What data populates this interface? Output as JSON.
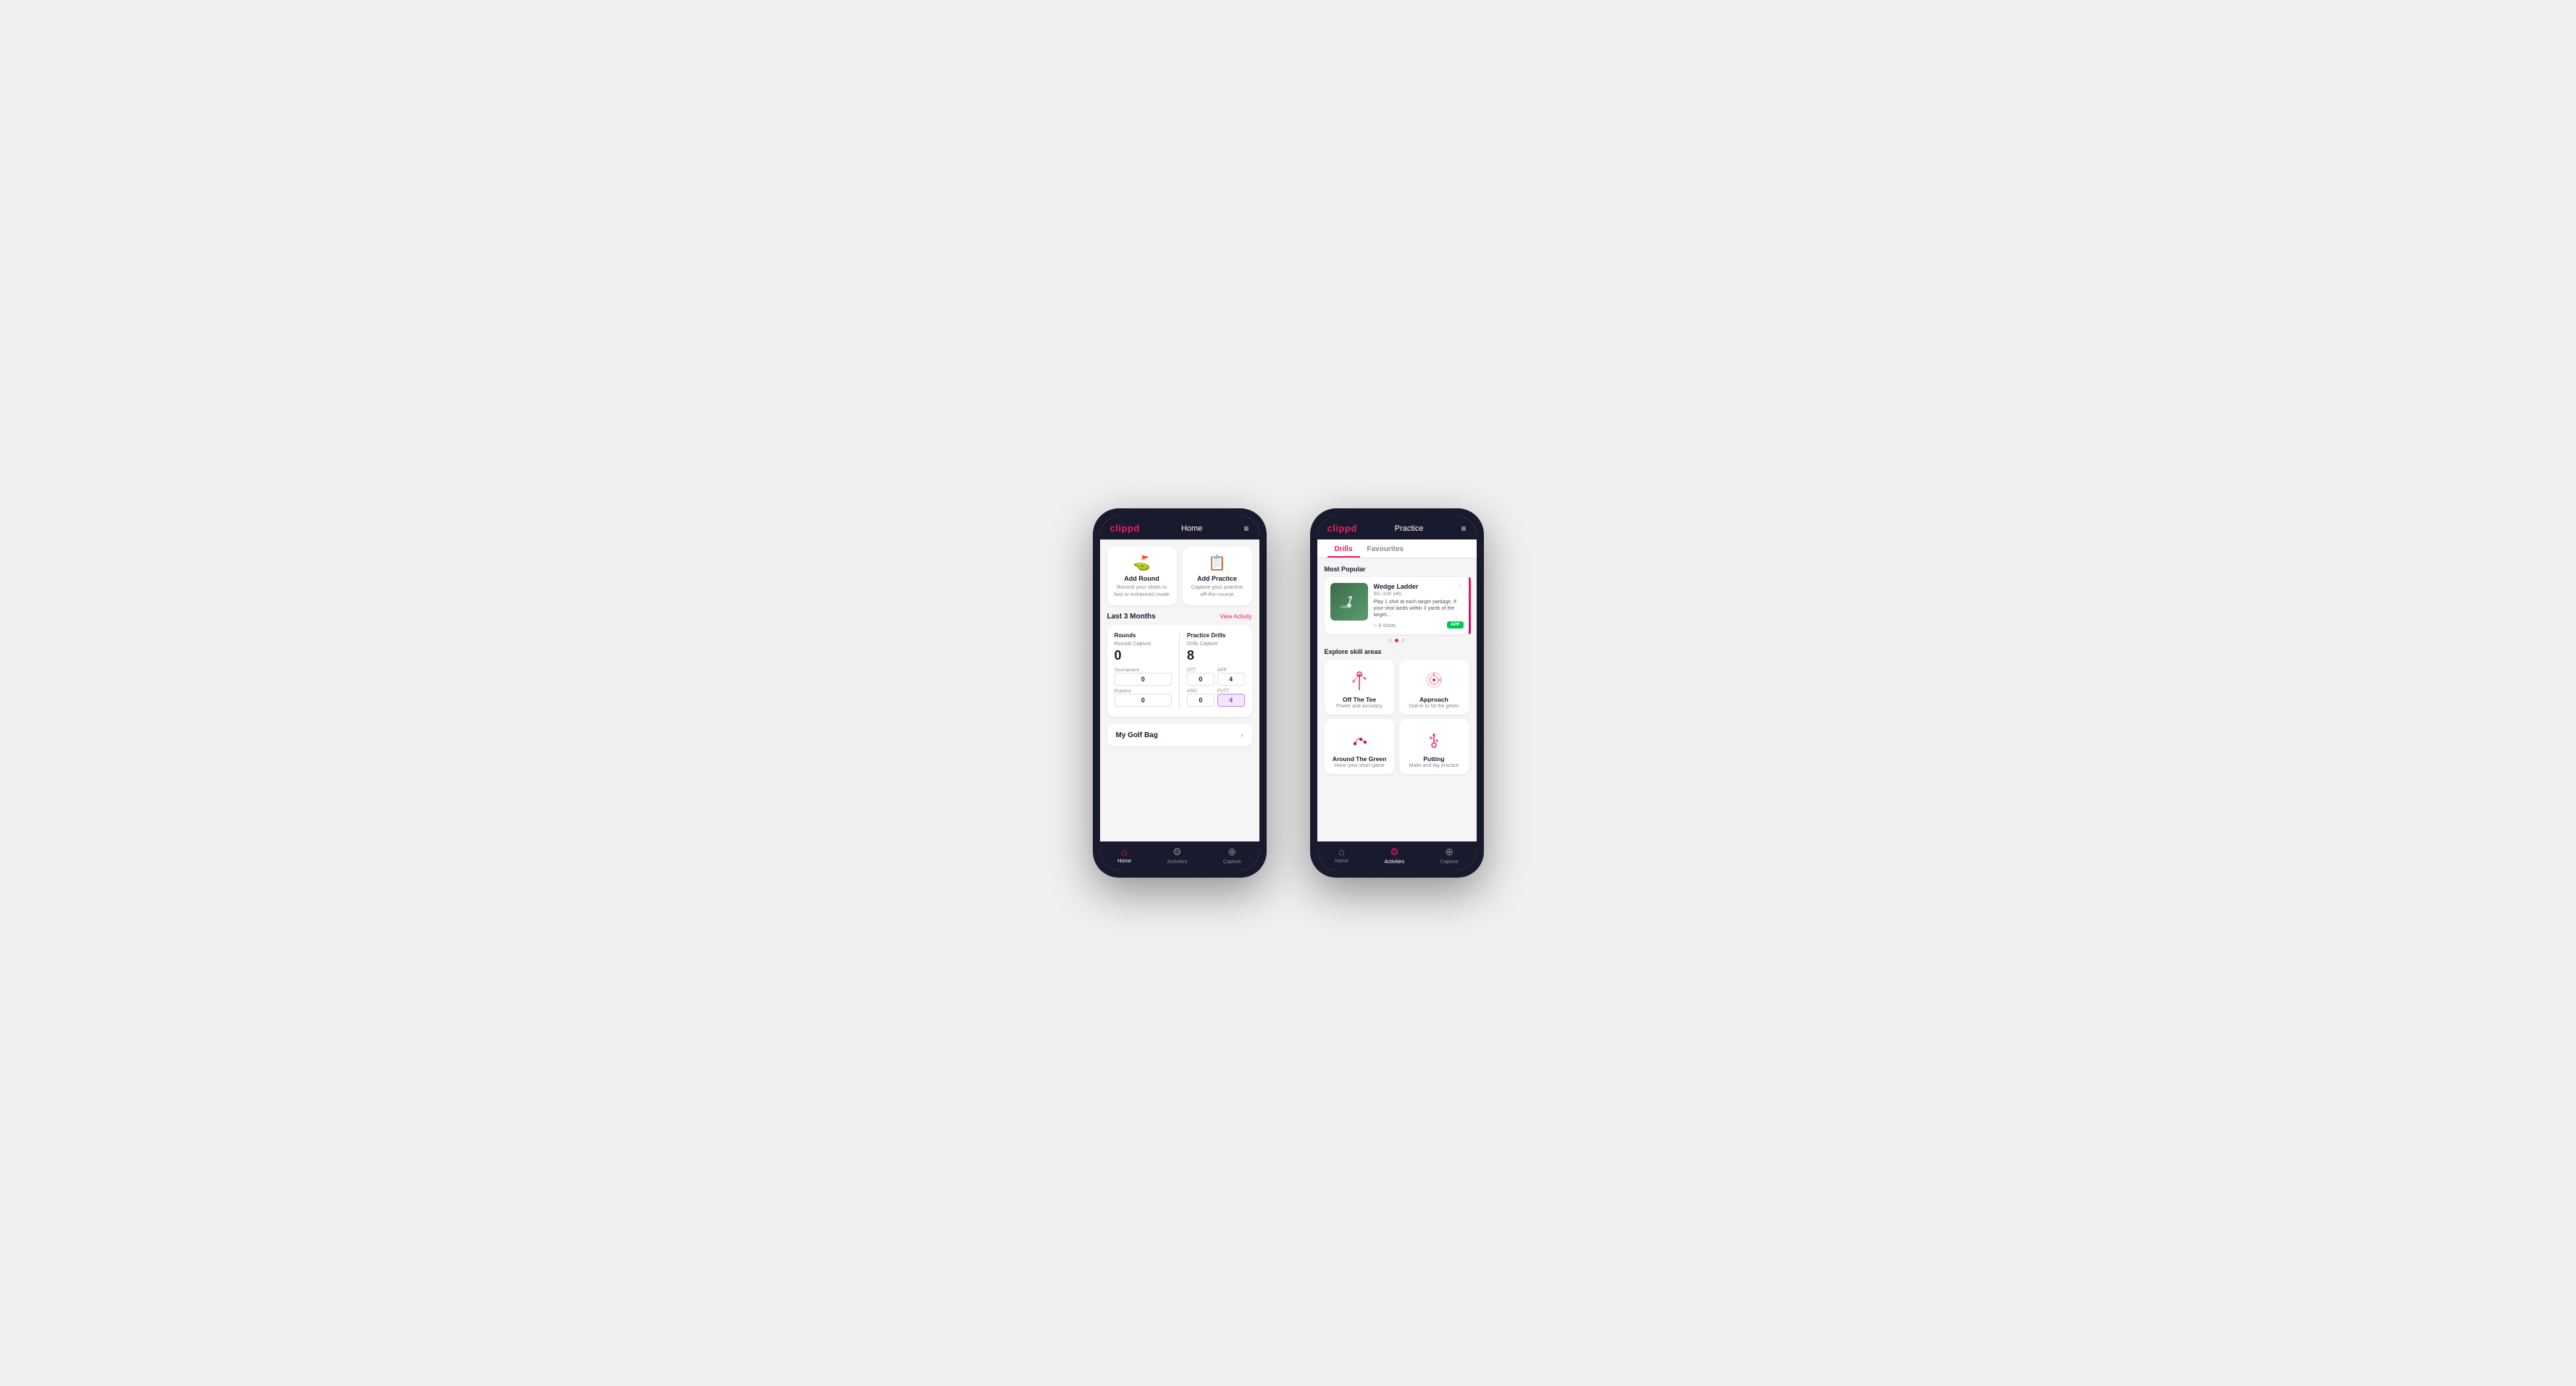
{
  "phone1": {
    "header": {
      "logo": "clippd",
      "title": "Home",
      "menu_icon": "≡"
    },
    "cards": [
      {
        "id": "add-round",
        "icon": "⛳",
        "title": "Add Round",
        "desc": "Record your shots in fast or enhanced mode"
      },
      {
        "id": "add-practice",
        "icon": "📋",
        "title": "Add Practice",
        "desc": "Capture your practice off-the-course"
      }
    ],
    "activity_section": {
      "title": "Last 3 Months",
      "link": "View Activity"
    },
    "rounds": {
      "title": "Rounds",
      "capture_label": "Rounds Capture",
      "big_num": "0",
      "sub_rows": [
        {
          "label": "Tournament",
          "value": "0"
        },
        {
          "label": "Practice",
          "value": "0"
        }
      ]
    },
    "drills": {
      "title": "Practice Drills",
      "capture_label": "Drills Capture",
      "big_num": "8",
      "sub_rows": [
        {
          "items": [
            {
              "label": "OTT",
              "value": "0",
              "highlight": false
            },
            {
              "label": "APP",
              "value": "4",
              "highlight": false
            }
          ]
        },
        {
          "items": [
            {
              "label": "ARG",
              "value": "0",
              "highlight": false
            },
            {
              "label": "PUTT",
              "value": "4",
              "highlight": true
            }
          ]
        }
      ]
    },
    "golf_bag": {
      "label": "My Golf Bag"
    },
    "nav": [
      {
        "label": "Home",
        "icon": "⌂",
        "active": true
      },
      {
        "label": "Activities",
        "icon": "☯",
        "active": false
      },
      {
        "label": "Capture",
        "icon": "⊕",
        "active": false
      }
    ]
  },
  "phone2": {
    "header": {
      "logo": "clippd",
      "title": "Practice",
      "menu_icon": "≡"
    },
    "tabs": [
      {
        "label": "Drills",
        "active": true
      },
      {
        "label": "Favourites",
        "active": false
      }
    ],
    "most_popular_label": "Most Popular",
    "featured": {
      "title": "Wedge Ladder",
      "yardage": "50–100 yds",
      "desc": "Play 1 shot at each target yardage. If your shot lands within 3 yards of the target...",
      "shots": "9 shots",
      "badge": "APP"
    },
    "dots": [
      {
        "active": false
      },
      {
        "active": true
      },
      {
        "active": false
      }
    ],
    "explore_label": "Explore skill areas",
    "skills": [
      {
        "id": "off-the-tee",
        "name": "Off The Tee",
        "desc": "Power and accuracy"
      },
      {
        "id": "approach",
        "name": "Approach",
        "desc": "Dial-in to hit the green"
      },
      {
        "id": "around-the-green",
        "name": "Around The Green",
        "desc": "Hone your short game"
      },
      {
        "id": "putting",
        "name": "Putting",
        "desc": "Make and lag practice"
      }
    ],
    "nav": [
      {
        "label": "Home",
        "icon": "⌂",
        "active": false
      },
      {
        "label": "Activities",
        "icon": "☯",
        "active": true
      },
      {
        "label": "Capture",
        "icon": "⊕",
        "active": false
      }
    ]
  }
}
